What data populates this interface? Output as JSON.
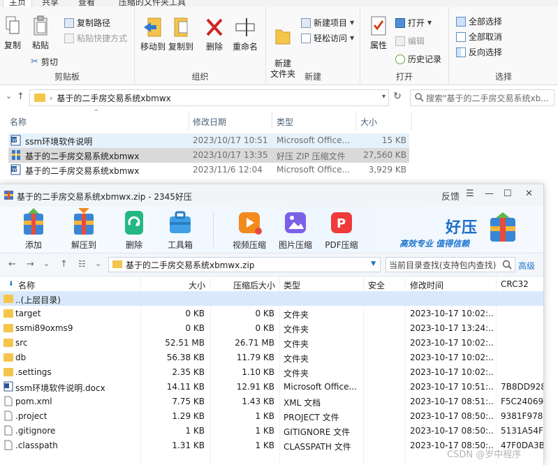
{
  "ribbon": {
    "tabs": [
      "主页",
      "共享",
      "查看",
      "压缩的文件夹工具"
    ],
    "clipboard": {
      "copy": "复制",
      "paste": "粘贴",
      "copy_path": "复制路径",
      "paste_shortcut": "粘贴快捷方式",
      "cut": "剪切",
      "label": "剪贴板"
    },
    "organize": {
      "move_to": "移动到",
      "copy_to": "复制到",
      "delete": "删除",
      "rename": "重命名",
      "label": "组织"
    },
    "new": {
      "new_folder": "新建\n文件夹",
      "new_item": "新建项目",
      "easy_access": "轻松访问",
      "label": "新建"
    },
    "open": {
      "properties": "属性",
      "open": "打开",
      "edit": "编辑",
      "history": "历史记录",
      "label": "打开"
    },
    "select": {
      "select_all": "全部选择",
      "select_none": "全部取消",
      "invert": "反向选择",
      "label": "选择"
    }
  },
  "explorer": {
    "address": "基于的二手房交易系统xbmwx",
    "search_placeholder": "搜索\"基于的二手房交易系统xb...",
    "columns": {
      "name": "名称",
      "date": "修改日期",
      "type": "类型",
      "size": "大小"
    },
    "files": [
      {
        "name": "ssm环境软件说明",
        "date": "2023/10/17 10:51",
        "type": "Microsoft Office...",
        "size": "15 KB"
      },
      {
        "name": "基于的二手房交易系统xbmwx",
        "date": "2023/10/17 13:35",
        "type": "好压 ZIP 压缩文件",
        "size": "27,560 KB"
      },
      {
        "name": "基于的二手房交易系统xbmwx",
        "date": "2023/11/6 12:04",
        "type": "Microsoft Office...",
        "size": "3,929 KB"
      }
    ]
  },
  "haozip": {
    "title": "基于的二手房交易系统xbmwx.zip - 2345好压",
    "feedback": "反馈",
    "toolbar": {
      "add": "添加",
      "extract": "解压到",
      "delete": "删除",
      "toolbox": "工具箱",
      "video_compress": "视频压缩",
      "image_compress": "图片压缩",
      "pdf_compress": "PDF压缩"
    },
    "brand": {
      "name": "好压",
      "slogan": "高效专业  值得信赖"
    },
    "path": "基于的二手房交易系统xbmwx.zip",
    "search_placeholder": "当前目录查找(支持包内查找)",
    "advanced": "高级",
    "columns": {
      "name": "名称",
      "size": "大小",
      "packed": "压缩后大小",
      "type": "类型",
      "security": "安全",
      "modified": "修改时间",
      "crc": "CRC32"
    },
    "parent_row": "..(上层目录)",
    "rows": [
      {
        "name": "target",
        "size": "0 KB",
        "packed": "0 KB",
        "type": "文件夹",
        "modified": "2023-10-17 10:02:...",
        "crc": "",
        "kind": "folder"
      },
      {
        "name": "ssmi89oxms9",
        "size": "0 KB",
        "packed": "0 KB",
        "type": "文件夹",
        "modified": "2023-10-17 13:24:...",
        "crc": "",
        "kind": "folder"
      },
      {
        "name": "src",
        "size": "52.51 MB",
        "packed": "26.71 MB",
        "type": "文件夹",
        "modified": "2023-10-17 10:02:...",
        "crc": "",
        "kind": "folder"
      },
      {
        "name": "db",
        "size": "56.38 KB",
        "packed": "11.79 KB",
        "type": "文件夹",
        "modified": "2023-10-17 10:02:...",
        "crc": "",
        "kind": "folder"
      },
      {
        "name": ".settings",
        "size": "2.35 KB",
        "packed": "1.10 KB",
        "type": "文件夹",
        "modified": "2023-10-17 10:02:...",
        "crc": "",
        "kind": "folder"
      },
      {
        "name": "ssm环境软件说明.docx",
        "size": "14.11 KB",
        "packed": "12.91 KB",
        "type": "Microsoft Office...",
        "modified": "2023-10-17 10:51:...",
        "crc": "7B8DD928",
        "kind": "doc"
      },
      {
        "name": "pom.xml",
        "size": "7.75 KB",
        "packed": "1.43 KB",
        "type": "XML 文档",
        "modified": "2023-10-17 08:51:...",
        "crc": "F5C24069",
        "kind": "file"
      },
      {
        "name": ".project",
        "size": "1.29 KB",
        "packed": "1 KB",
        "type": "PROJECT 文件",
        "modified": "2023-10-17 08:50:...",
        "crc": "9381F978",
        "kind": "file"
      },
      {
        "name": ".gitignore",
        "size": "1 KB",
        "packed": "1 KB",
        "type": "GITIGNORE 文件",
        "modified": "2023-10-17 08:50:...",
        "crc": "5131A54F",
        "kind": "file"
      },
      {
        "name": ".classpath",
        "size": "1.31 KB",
        "packed": "1 KB",
        "type": "CLASSPATH 文件",
        "modified": "2023-10-17 08:50:...",
        "crc": "47F0DA3B",
        "kind": "file"
      }
    ]
  },
  "watermark": "CSDN @岁中程序",
  "colors": {
    "accent": "#1c6ec9",
    "selection": "#e5f1fb",
    "folder": "#f4c54b"
  }
}
